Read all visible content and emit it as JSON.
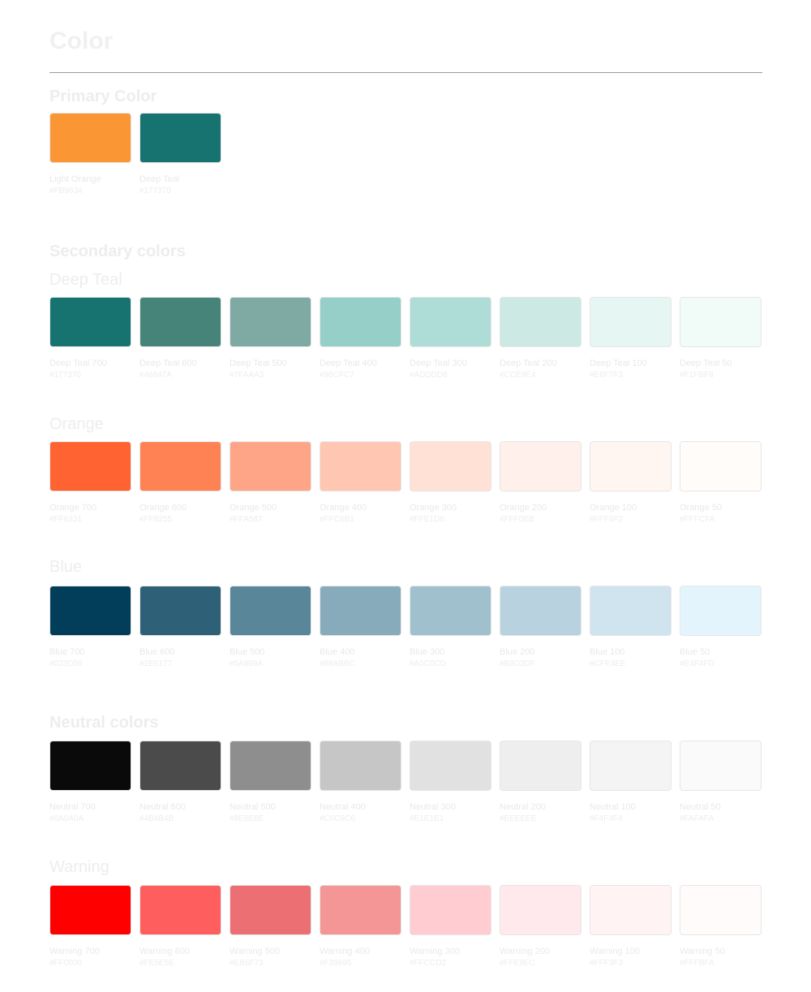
{
  "page": {
    "title": "Color"
  },
  "primary": {
    "heading": "Primary Color",
    "colors": [
      {
        "name": "Light Orange",
        "hex": "#FB9634",
        "color": "#FB9634"
      },
      {
        "name": "Deep Teal",
        "hex": "#177370",
        "color": "#177370"
      }
    ]
  },
  "secondary": {
    "heading": "Secondary colors"
  },
  "groups": [
    {
      "heading": "Deep Teal",
      "colors": [
        {
          "name": "Deep Teal 700",
          "hex": "#177370",
          "color": "#177370"
        },
        {
          "name": "Deep Teal 600",
          "hex": "#46847A",
          "color": "#46847A"
        },
        {
          "name": "Deep Teal 500",
          "hex": "#7FAAA3",
          "color": "#7FAAA3"
        },
        {
          "name": "Deep Teal 400",
          "hex": "#96CFC7",
          "color": "#96CFC7"
        },
        {
          "name": "Deep Teal 300",
          "hex": "#ADDDD6",
          "color": "#ADDDD6"
        },
        {
          "name": "Deep Teal 200",
          "hex": "#CCE9E4",
          "color": "#CCE9E4"
        },
        {
          "name": "Deep Teal 100",
          "hex": "#E6F7F3",
          "color": "#E6F7F3"
        },
        {
          "name": "Deep Teal 50",
          "hex": "#F1FBF8",
          "color": "#F1FBF8"
        }
      ]
    },
    {
      "heading": "Orange",
      "colors": [
        {
          "name": "Orange 700",
          "hex": "#FF6331",
          "color": "#FF6331"
        },
        {
          "name": "Orange 600",
          "hex": "#FF8255",
          "color": "#FF8255"
        },
        {
          "name": "Orange 500",
          "hex": "#FFA587",
          "color": "#FFA587"
        },
        {
          "name": "Orange 400",
          "hex": "#FFC6B1",
          "color": "#FFC6B1"
        },
        {
          "name": "Orange 300",
          "hex": "#FFE1D6",
          "color": "#FFE1D6"
        },
        {
          "name": "Orange 200",
          "hex": "#FFF0EB",
          "color": "#FFF0EB"
        },
        {
          "name": "Orange 100",
          "hex": "#FFF6F2",
          "color": "#FFF6F2"
        },
        {
          "name": "Orange 50",
          "hex": "#FFFCFA",
          "color": "#FFFCFA"
        }
      ]
    },
    {
      "heading": "Blue",
      "colors": [
        {
          "name": "Blue 700",
          "hex": "#023D59",
          "color": "#023D59"
        },
        {
          "name": "Blue 600",
          "hex": "#2E6177",
          "color": "#2E6177"
        },
        {
          "name": "Blue 500",
          "hex": "#5A869A",
          "color": "#5A869A"
        },
        {
          "name": "Blue 400",
          "hex": "#88ABBC",
          "color": "#88ABBC"
        },
        {
          "name": "Blue 300",
          "hex": "#A0C0CD",
          "color": "#A0C0CD"
        },
        {
          "name": "Blue 200",
          "hex": "#B8D3DF",
          "color": "#B8D3DF"
        },
        {
          "name": "Blue 100",
          "hex": "#CFE4EE",
          "color": "#CFE4EE"
        },
        {
          "name": "Blue 50",
          "hex": "#E4F4FD",
          "color": "#E4F4FD"
        }
      ]
    },
    {
      "heading": "Neutral colors",
      "bold": true,
      "colors": [
        {
          "name": "Neutral 700",
          "hex": "#0A0A0A",
          "color": "#0A0A0A"
        },
        {
          "name": "Neutral 600",
          "hex": "#4B4B4B",
          "color": "#4B4B4B"
        },
        {
          "name": "Neutral 500",
          "hex": "#8E8E8E",
          "color": "#8E8E8E"
        },
        {
          "name": "Neutral 400",
          "hex": "#C6C6C6",
          "color": "#C6C6C6"
        },
        {
          "name": "Neutral 300",
          "hex": "#E1E1E1",
          "color": "#E1E1E1"
        },
        {
          "name": "Neutral 200",
          "hex": "#EEEEEE",
          "color": "#EEEEEE"
        },
        {
          "name": "Neutral 100",
          "hex": "#F4F4F4",
          "color": "#F4F4F4"
        },
        {
          "name": "Neutral 50",
          "hex": "#FAFAFA",
          "color": "#FAFAFA"
        }
      ]
    },
    {
      "heading": "Warning",
      "colors": [
        {
          "name": "Warning 700",
          "hex": "#FF0000",
          "color": "#FF0000"
        },
        {
          "name": "Warning 600",
          "hex": "#FE5E5E",
          "color": "#FE5E5E"
        },
        {
          "name": "Warning 500",
          "hex": "#EB6F73",
          "color": "#EB6F73"
        },
        {
          "name": "Warning 400",
          "hex": "#F39695",
          "color": "#F39695"
        },
        {
          "name": "Warning 300",
          "hex": "#FFCCD2",
          "color": "#FFCCD2"
        },
        {
          "name": "Warning 200",
          "hex": "#FFE9EC",
          "color": "#FFE9EC"
        },
        {
          "name": "Warning 100",
          "hex": "#FFF3F3",
          "color": "#FFF3F3"
        },
        {
          "name": "Warning 50",
          "hex": "#FFFBFA",
          "color": "#FFFBFA"
        }
      ]
    }
  ]
}
